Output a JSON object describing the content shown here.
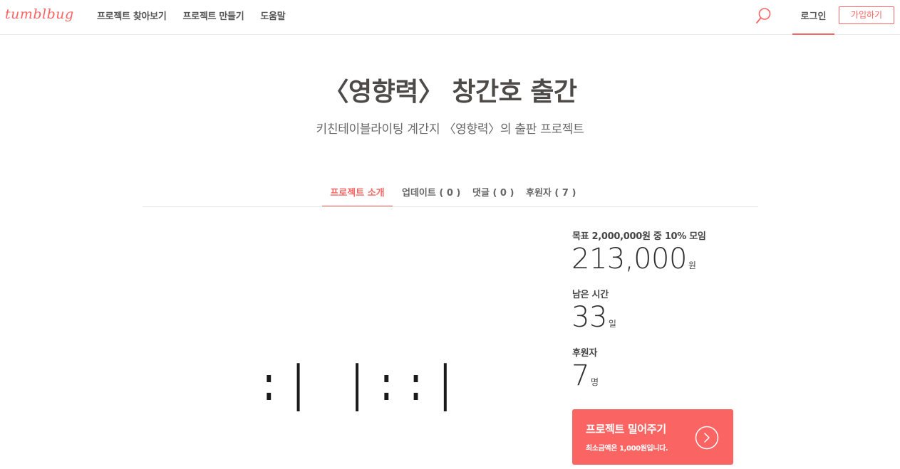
{
  "header": {
    "logo": "tumblbug",
    "nav": [
      "프로젝트 찾아보기",
      "프로젝트 만들기",
      "도움말"
    ],
    "login_label": "로그인",
    "signup_label": "가입하기",
    "search_icon": "search-icon",
    "accent_color": "#fa6462"
  },
  "project": {
    "title": "〈영향력〉 창간호 출간",
    "subtitle": "키친테이블라이팅 계간지 〈영향력〉의 출판 프로젝트"
  },
  "tabs": [
    {
      "label": "프로젝트 소개",
      "active": true
    },
    {
      "label": "업데이트 ( 0 )",
      "active": false
    },
    {
      "label": "댓글 ( 0 )",
      "active": false
    },
    {
      "label": "후원자 ( 7 )",
      "active": false
    }
  ],
  "media": {
    "text": ":| |::|"
  },
  "stats": {
    "goal_label": "목표 2,000,000원 중 10% 모임",
    "amount": "213,000",
    "amount_unit": "원",
    "time_label": "남은 시간",
    "days": "33",
    "days_unit": "일",
    "backers_label": "후원자",
    "backers": "7",
    "backers_unit": "명"
  },
  "cta": {
    "title": "프로젝트 밀어주기",
    "subtitle": "최소금액은 1,000원입니다.",
    "arrow_icon": "chevron-right-circle-icon"
  }
}
